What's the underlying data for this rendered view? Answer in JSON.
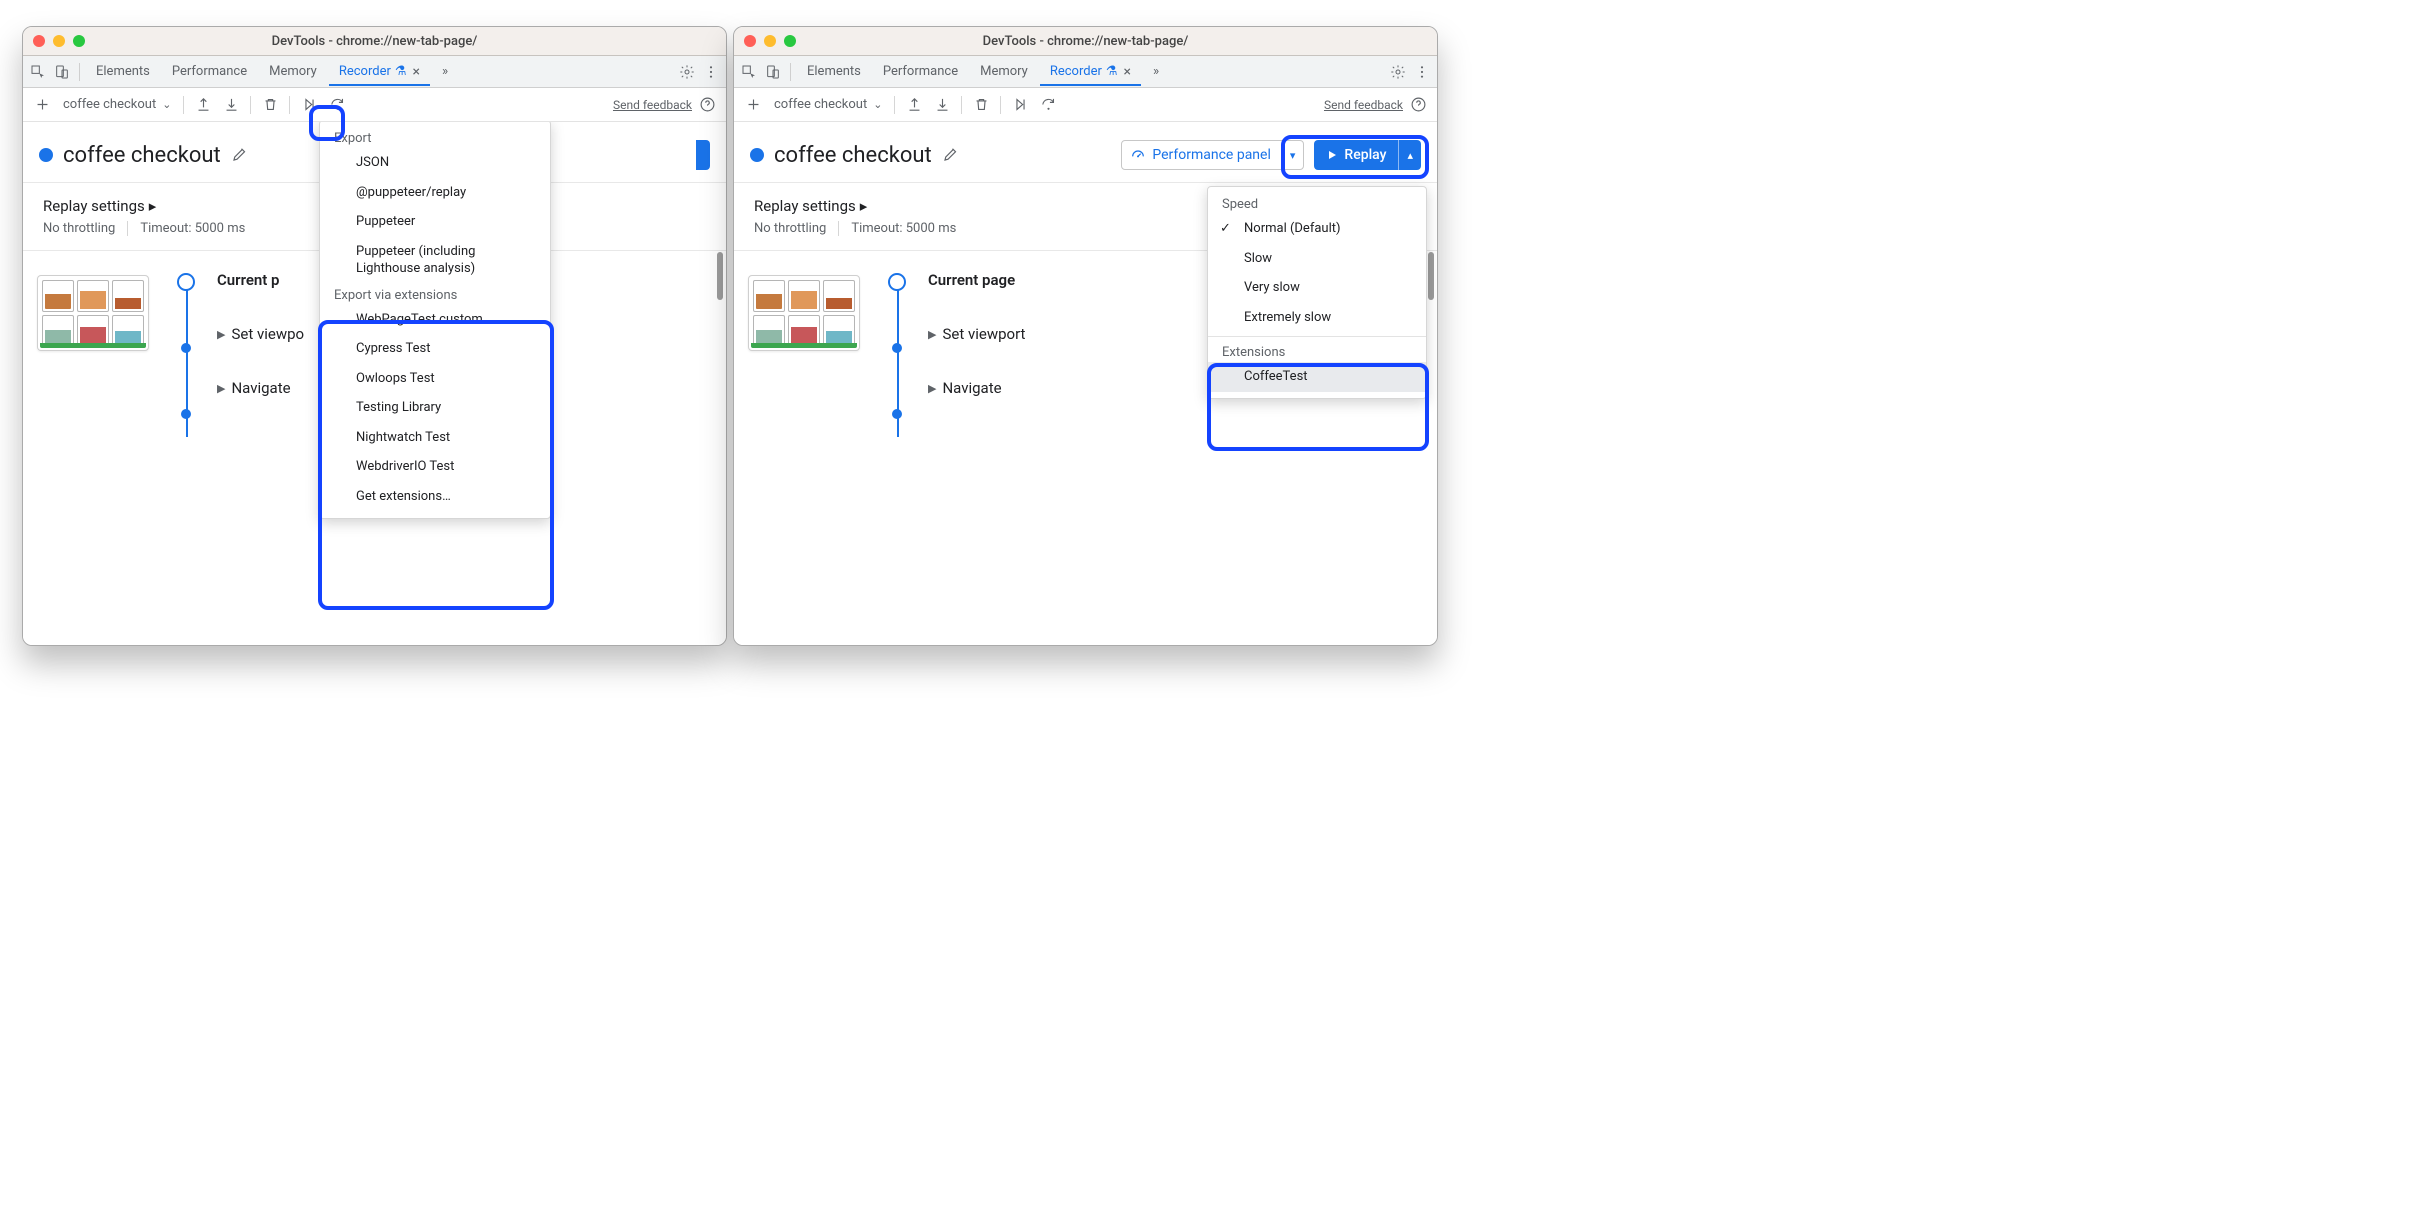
{
  "title": "DevTools - chrome://new-tab-page/",
  "tabs": {
    "elements": "Elements",
    "performance": "Performance",
    "memory": "Memory",
    "recorder": "Recorder"
  },
  "more_tabs_glyph": "»",
  "toolbar": {
    "recording_name": "coffee checkout",
    "send_feedback": "Send feedback"
  },
  "recording": {
    "title": "coffee checkout",
    "perf_panel": "Performance panel",
    "replay": "Replay"
  },
  "settings": {
    "label": "Replay settings",
    "throttling": "No throttling",
    "timeout": "Timeout: 5000 ms"
  },
  "steps": {
    "current": "Current page",
    "current_left_trunc": "Current p",
    "set_viewport": "Set viewport",
    "set_viewport_trunc": "Set viewpo",
    "navigate": "Navigate"
  },
  "export_menu": {
    "title": "Export",
    "items": [
      "JSON",
      "@puppeteer/replay",
      "Puppeteer",
      "Puppeteer (including Lighthouse analysis)"
    ],
    "ext_title": "Export via extensions",
    "ext_items": [
      "WebPageTest custom",
      "Cypress Test",
      "Owloops Test",
      "Testing Library",
      "Nightwatch Test",
      "WebdriverIO Test",
      "Get extensions…"
    ]
  },
  "replay_menu": {
    "speed_title": "Speed",
    "speed_items": [
      "Normal (Default)",
      "Slow",
      "Very slow",
      "Extremely slow"
    ],
    "ext_title": "Extensions",
    "ext_items": [
      "CoffeeTest"
    ]
  }
}
